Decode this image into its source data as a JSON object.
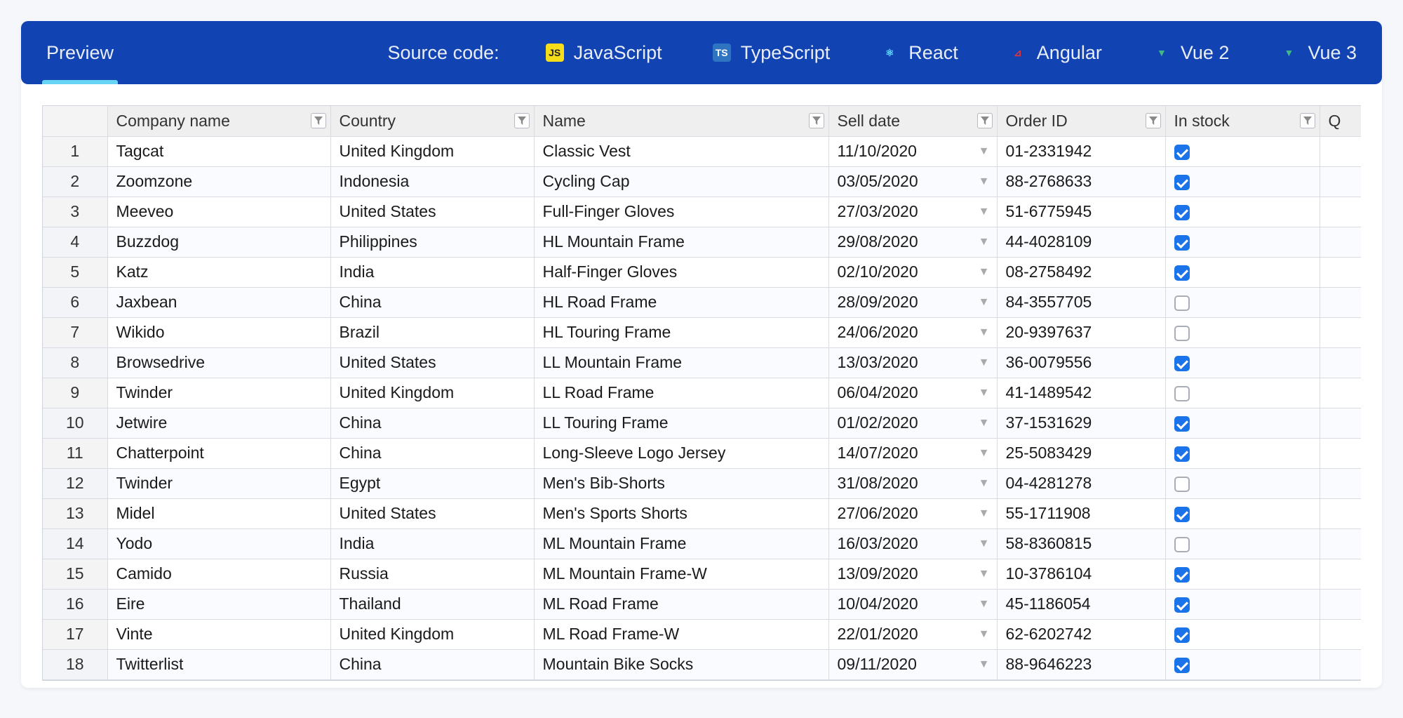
{
  "tabs": {
    "preview": "Preview",
    "source_label": "Source code:",
    "langs": {
      "js": "JavaScript",
      "ts": "TypeScript",
      "react": "React",
      "angular": "Angular",
      "vue2": "Vue 2",
      "vue3": "Vue 3"
    }
  },
  "table": {
    "headers": {
      "company": "Company name",
      "country": "Country",
      "name": "Name",
      "sell_date": "Sell date",
      "order_id": "Order ID",
      "in_stock": "In stock",
      "qty_cut": "Q"
    },
    "rows": [
      {
        "n": "1",
        "company": "Tagcat",
        "country": "United Kingdom",
        "name": "Classic Vest",
        "date": "11/10/2020",
        "order": "01-2331942",
        "stock": true
      },
      {
        "n": "2",
        "company": "Zoomzone",
        "country": "Indonesia",
        "name": "Cycling Cap",
        "date": "03/05/2020",
        "order": "88-2768633",
        "stock": true
      },
      {
        "n": "3",
        "company": "Meeveo",
        "country": "United States",
        "name": "Full-Finger Gloves",
        "date": "27/03/2020",
        "order": "51-6775945",
        "stock": true
      },
      {
        "n": "4",
        "company": "Buzzdog",
        "country": "Philippines",
        "name": "HL Mountain Frame",
        "date": "29/08/2020",
        "order": "44-4028109",
        "stock": true
      },
      {
        "n": "5",
        "company": "Katz",
        "country": "India",
        "name": "Half-Finger Gloves",
        "date": "02/10/2020",
        "order": "08-2758492",
        "stock": true
      },
      {
        "n": "6",
        "company": "Jaxbean",
        "country": "China",
        "name": "HL Road Frame",
        "date": "28/09/2020",
        "order": "84-3557705",
        "stock": false
      },
      {
        "n": "7",
        "company": "Wikido",
        "country": "Brazil",
        "name": "HL Touring Frame",
        "date": "24/06/2020",
        "order": "20-9397637",
        "stock": false
      },
      {
        "n": "8",
        "company": "Browsedrive",
        "country": "United States",
        "name": "LL Mountain Frame",
        "date": "13/03/2020",
        "order": "36-0079556",
        "stock": true
      },
      {
        "n": "9",
        "company": "Twinder",
        "country": "United Kingdom",
        "name": "LL Road Frame",
        "date": "06/04/2020",
        "order": "41-1489542",
        "stock": false
      },
      {
        "n": "10",
        "company": "Jetwire",
        "country": "China",
        "name": "LL Touring Frame",
        "date": "01/02/2020",
        "order": "37-1531629",
        "stock": true
      },
      {
        "n": "11",
        "company": "Chatterpoint",
        "country": "China",
        "name": "Long-Sleeve Logo Jersey",
        "date": "14/07/2020",
        "order": "25-5083429",
        "stock": true
      },
      {
        "n": "12",
        "company": "Twinder",
        "country": "Egypt",
        "name": "Men's Bib-Shorts",
        "date": "31/08/2020",
        "order": "04-4281278",
        "stock": false
      },
      {
        "n": "13",
        "company": "Midel",
        "country": "United States",
        "name": "Men's Sports Shorts",
        "date": "27/06/2020",
        "order": "55-1711908",
        "stock": true
      },
      {
        "n": "14",
        "company": "Yodo",
        "country": "India",
        "name": "ML Mountain Frame",
        "date": "16/03/2020",
        "order": "58-8360815",
        "stock": false
      },
      {
        "n": "15",
        "company": "Camido",
        "country": "Russia",
        "name": "ML Mountain Frame-W",
        "date": "13/09/2020",
        "order": "10-3786104",
        "stock": true
      },
      {
        "n": "16",
        "company": "Eire",
        "country": "Thailand",
        "name": "ML Road Frame",
        "date": "10/04/2020",
        "order": "45-1186054",
        "stock": true
      },
      {
        "n": "17",
        "company": "Vinte",
        "country": "United Kingdom",
        "name": "ML Road Frame-W",
        "date": "22/01/2020",
        "order": "62-6202742",
        "stock": true
      },
      {
        "n": "18",
        "company": "Twitterlist",
        "country": "China",
        "name": "Mountain Bike Socks",
        "date": "09/11/2020",
        "order": "88-9646223",
        "stock": true
      }
    ]
  }
}
